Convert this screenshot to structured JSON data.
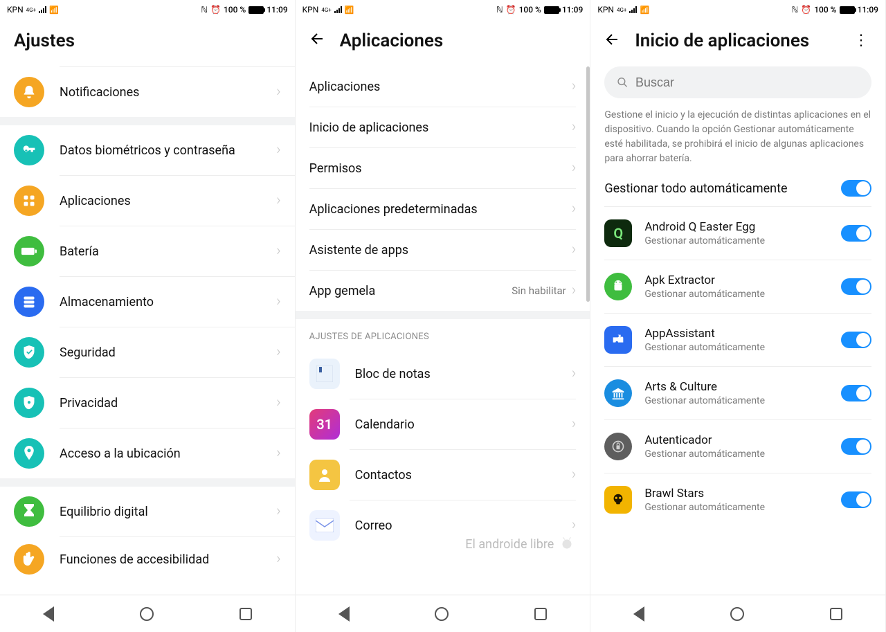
{
  "statusbar": {
    "carrier_left": "KPN",
    "net_tag": "4G+",
    "battery_pct": "100 %",
    "time": "11:09"
  },
  "screen1": {
    "title": "Ajustes",
    "items": [
      {
        "label": "Notificaciones",
        "color": "#f5a623",
        "icon": "bell"
      },
      {
        "gap": true
      },
      {
        "label": "Datos biométricos y contraseña",
        "color": "#17c1b6",
        "icon": "key"
      },
      {
        "label": "Aplicaciones",
        "color": "#f5a623",
        "icon": "grid"
      },
      {
        "label": "Batería",
        "color": "#3fbd3f",
        "icon": "battery"
      },
      {
        "label": "Almacenamiento",
        "color": "#2a6bf0",
        "icon": "storage"
      },
      {
        "label": "Seguridad",
        "color": "#17c1b6",
        "icon": "shield"
      },
      {
        "label": "Privacidad",
        "color": "#17c1b6",
        "icon": "privacy"
      },
      {
        "label": "Acceso a la ubicación",
        "color": "#17c1b6",
        "icon": "location"
      },
      {
        "gap": true
      },
      {
        "label": "Equilibrio digital",
        "color": "#3fbd3f",
        "icon": "hourglass"
      },
      {
        "label": "Funciones de accesibilidad",
        "color": "#f5a623",
        "icon": "hand"
      }
    ]
  },
  "screen2": {
    "title": "Aplicaciones",
    "items": [
      {
        "label": "Aplicaciones"
      },
      {
        "label": "Inicio de aplicaciones"
      },
      {
        "label": "Permisos"
      },
      {
        "label": "Aplicaciones predeterminadas"
      },
      {
        "label": "Asistente de apps"
      },
      {
        "label": "App gemela",
        "value": "Sin habilitar"
      }
    ],
    "section_title": "AJUSTES DE APLICACIONES",
    "apps": [
      {
        "label": "Bloc de notas",
        "bg": "#e9f1f9",
        "fg": "#3a5fa0",
        "glyph": "bookmark"
      },
      {
        "label": "Calendario",
        "bg": "#e23b7a",
        "fg": "#ffffff",
        "glyph": "31"
      },
      {
        "label": "Contactos",
        "bg": "#f4c542",
        "fg": "#ffffff",
        "glyph": "person"
      },
      {
        "label": "Correo",
        "bg": "#e8efff",
        "fg": "#6b8cff",
        "glyph": "mail"
      }
    ],
    "watermark": "El androide libre"
  },
  "screen3": {
    "title": "Inicio de aplicaciones",
    "search_placeholder": "Buscar",
    "description": "Gestione el inicio y la ejecución de distintas aplicaciones en el dispositivo. Cuando la opción Gestionar automáticamente esté habilitada, se prohibirá el inicio de algunas aplicaciones para ahorrar batería.",
    "master_toggle": "Gestionar todo automáticamente",
    "sub_label": "Gestionar automáticamente",
    "apps": [
      {
        "name": "Android Q Easter Egg",
        "bg": "#0e2a0e",
        "fg": "#7be87b",
        "glyph": "Q"
      },
      {
        "name": "Apk Extractor",
        "bg": "#3fbd3f",
        "fg": "#ffffff",
        "glyph": "android"
      },
      {
        "name": "AppAssistant",
        "bg": "#2a6bf0",
        "fg": "#ffffff",
        "glyph": "puzzle"
      },
      {
        "name": "Arts & Culture",
        "bg": "#1a8de0",
        "fg": "#ffffff",
        "glyph": "museum"
      },
      {
        "name": "Autenticador",
        "bg": "#5e5e5e",
        "fg": "#cfcfcf",
        "glyph": "lock"
      },
      {
        "name": "Brawl Stars",
        "bg": "#f2b400",
        "fg": "#3b2e00",
        "glyph": "skull"
      }
    ]
  }
}
